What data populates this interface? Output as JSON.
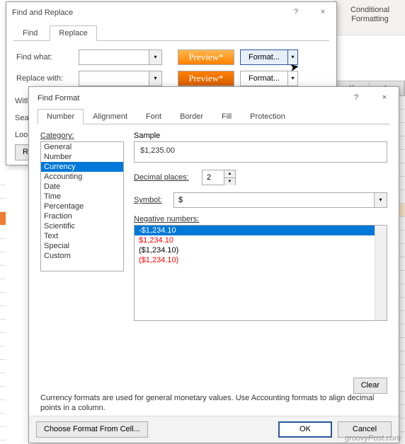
{
  "ribbon": {
    "cf": "Conditional Formatting"
  },
  "cols": {
    "k": "K",
    "l": "L"
  },
  "dlg1": {
    "title": "Find and Replace",
    "help": "?",
    "close": "×",
    "tabs": {
      "find": "Find",
      "replace": "Replace"
    },
    "find_what_label": "Find what:",
    "replace_with_label": "Replace with:",
    "preview1": "Preview*",
    "preview2": "Preview*",
    "format": "Format...",
    "within": "Witl",
    "search": "Sear",
    "lookin": "Lool",
    "replace_btn": "Rep"
  },
  "dlg2": {
    "title": "Find Format",
    "help": "?",
    "close": "×",
    "tabs": {
      "number": "Number",
      "alignment": "Alignment",
      "font": "Font",
      "border": "Border",
      "fill": "Fill",
      "protection": "Protection"
    },
    "category_label": "Category:",
    "categories": [
      "General",
      "Number",
      "Currency",
      "Accounting",
      "Date",
      "Time",
      "Percentage",
      "Fraction",
      "Scientific",
      "Text",
      "Special",
      "Custom"
    ],
    "sample_label": "Sample",
    "sample_value": "$1,235.00",
    "dec_label": "Decimal places:",
    "dec_value": "2",
    "symbol_label": "Symbol:",
    "symbol_value": "$",
    "neg_label": "Negative numbers:",
    "neg_items": [
      "-$1,234.10",
      "$1,234.10",
      "($1,234.10)",
      "($1,234.10)"
    ],
    "desc": "Currency formats are used for general monetary values.  Use Accounting formats to align decimal points in a column.",
    "clear": "Clear",
    "choose": "Choose Format From Cell...",
    "ok": "OK",
    "cancel": "Cancel"
  },
  "watermark": "groovyPost.com"
}
